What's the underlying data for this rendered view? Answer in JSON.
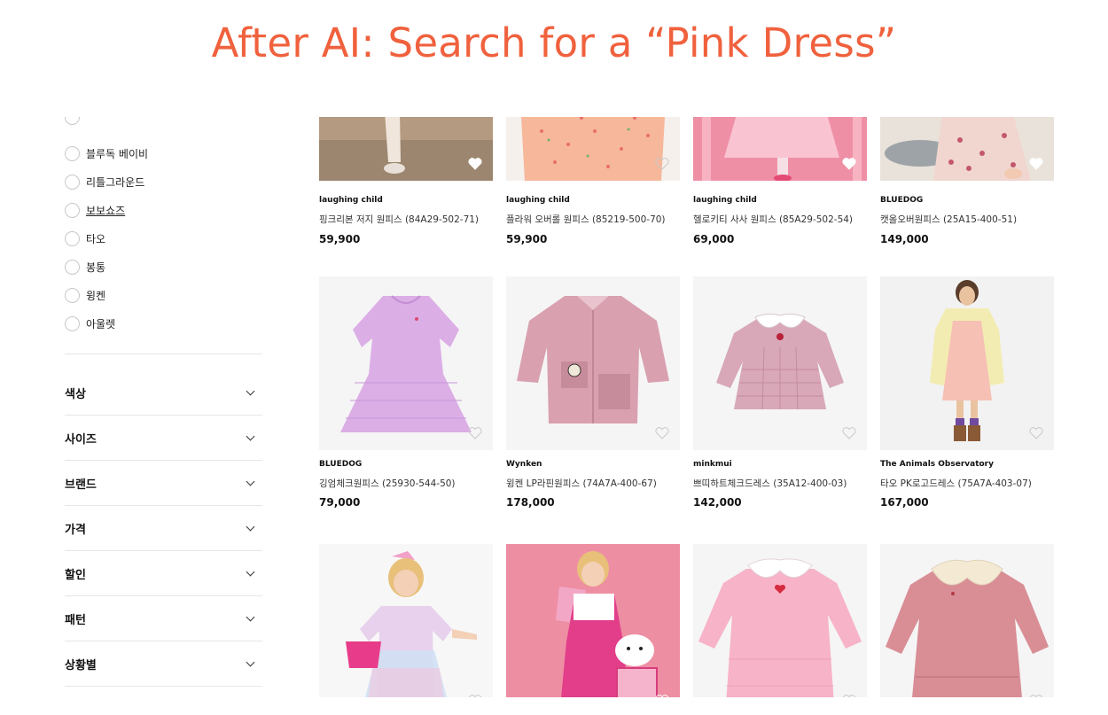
{
  "headline": "After AI: Search for a “Pink Dress”",
  "sidebar": {
    "brand_filters": [
      {
        "label": "블루독 베이비",
        "underlined": false
      },
      {
        "label": "리틀그라운드",
        "underlined": false
      },
      {
        "label": "보보쇼즈",
        "underlined": true
      },
      {
        "label": "타오",
        "underlined": false
      },
      {
        "label": "봉통",
        "underlined": false
      },
      {
        "label": "윙켄",
        "underlined": false
      },
      {
        "label": "아울렛",
        "underlined": false
      }
    ],
    "filter_groups": [
      "색상",
      "사이즈",
      "브랜드",
      "가격",
      "할인",
      "패턴",
      "상황별"
    ]
  },
  "products": [
    {
      "brand": "laughing child",
      "name": "핑크리본 저지 원피스 (84A29-502-71)",
      "price": "59,900",
      "image": "girl legs in cream leggings with red skirt on stone floor",
      "heart_filled": true
    },
    {
      "brand": "laughing child",
      "name": "플라워 오버롤 원피스 (85219-500-70)",
      "price": "59,900",
      "image": "peach dress with small floral print",
      "heart_filled": false
    },
    {
      "brand": "laughing child",
      "name": "헬로키티 사사 원피스 (85A29-502-54)",
      "price": "69,000",
      "image": "girl in pink tulle dress on pink background",
      "heart_filled": true
    },
    {
      "brand": "BLUEDOG",
      "name": "캣올오버원피스 (25A15-400-51)",
      "price": "149,000",
      "image": "girl in pink cat print dress sitting on floor",
      "heart_filled": true
    },
    {
      "brand": "BLUEDOG",
      "name": "깅엄체크원피스 (25930-544-50)",
      "price": "79,000",
      "image": "lavender gingham check dress flat lay",
      "heart_filled": false
    },
    {
      "brand": "Wynken",
      "name": "윙켄 LP라핀원피스 (74A7A-400-67)",
      "price": "178,000",
      "image": "pink striped shirt dress with patch pocket",
      "heart_filled": false
    },
    {
      "brand": "minkmui",
      "name": "쁘띠하트체크드레스 (35A12-400-03)",
      "price": "142,000",
      "image": "pink check dress with white collar",
      "heart_filled": false
    },
    {
      "brand": "The Animals Observatory",
      "name": "타오 PK로고드레스 (75A7A-403-07)",
      "price": "167,000",
      "image": "girl in peach dress with yellow cardigan",
      "heart_filled": false
    },
    {
      "brand": "",
      "name": "",
      "price": "",
      "image": "girl in pastel rainbow tulle dress with pink bag",
      "heart_filled": false
    },
    {
      "brand": "",
      "name": "",
      "price": "",
      "image": "girl in pink pinafore with hello kitty cart",
      "heart_filled": false
    },
    {
      "brand": "",
      "name": "",
      "price": "",
      "image": "pink tiered dress with white collar",
      "heart_filled": false
    },
    {
      "brand": "",
      "name": "",
      "price": "",
      "image": "dusty rose corduroy dress with cream collar",
      "heart_filled": false
    }
  ],
  "colors": {
    "accent": "#f0613d",
    "pink": "#ef9fb0",
    "text": "#111111"
  }
}
